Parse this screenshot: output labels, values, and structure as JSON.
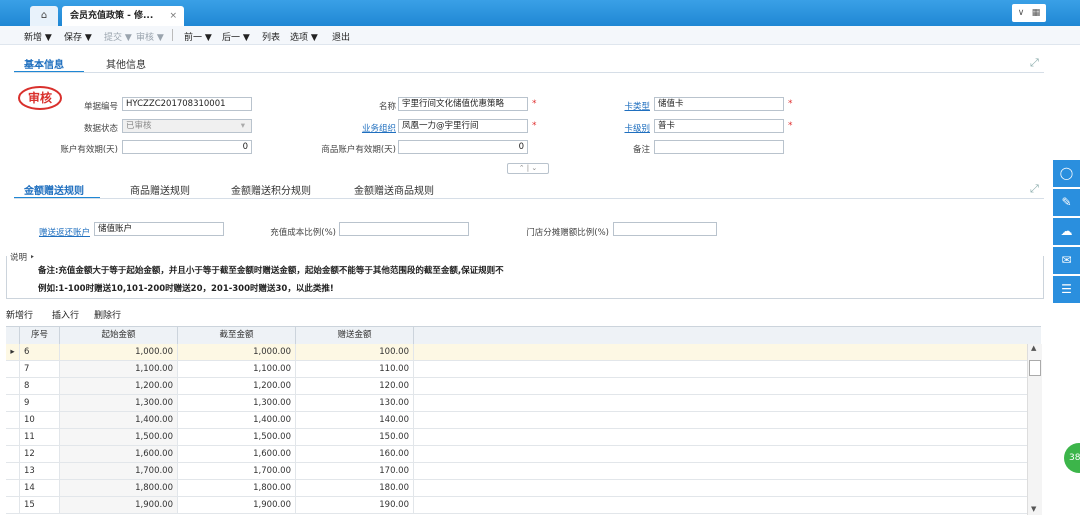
{
  "tabs": {
    "home_icon": "home-icon",
    "doc_tab_label": "会员充值政策 - 修...",
    "close_label": "×"
  },
  "toolbar": {
    "items": [
      {
        "label": "新增 ▼",
        "disabled": false
      },
      {
        "label": "保存 ▼",
        "disabled": false
      },
      {
        "label": "提交 ▼",
        "disabled": true
      },
      {
        "label": "审核 ▼",
        "disabled": true
      },
      {
        "label": "前一 ▼",
        "disabled": false
      },
      {
        "label": "后一 ▼",
        "disabled": false
      },
      {
        "label": "列表",
        "disabled": false
      },
      {
        "label": "选项 ▼",
        "disabled": false
      },
      {
        "label": "退出",
        "disabled": false
      }
    ]
  },
  "header_tabs": {
    "basic": "基本信息",
    "other": "其他信息"
  },
  "stamp": "审核",
  "form": {
    "bill_no_label": "单据编号",
    "bill_no": "HYCZZC201708310001",
    "name_label": "名称",
    "name": "宇里行间文化储值优惠策略",
    "card_type_label": "卡类型",
    "card_type": "储值卡",
    "status_label": "数据状态",
    "status": "已审核",
    "org_label": "业务组织",
    "org": "凤凰一力@宇里行间",
    "card_level_label": "卡级别",
    "card_level": "普卡",
    "valid_days_label": "账户有效期(天)",
    "valid_days": "0",
    "goods_valid_days_label": "商品账户有效期(天)",
    "goods_valid_days": "0",
    "remark_label": "备注",
    "remark": "",
    "req_mark": "*"
  },
  "rule_tabs": [
    "金额赠送规则",
    "商品赠送规则",
    "金额赠送积分规则",
    "金额赠送商品规则"
  ],
  "rule_fields": {
    "return_account_label": "赠送返还账户",
    "return_account": "储值账户",
    "cost_ratio_label": "充值成本比例(%)",
    "cost_ratio": "",
    "store_ratio_label": "门店分摊赠额比例(%)",
    "store_ratio": ""
  },
  "note": {
    "label": "说明",
    "line1": "备注:充值金额大于等于起始金额，并且小于等于截至金额时赠送金额，起始金额不能等于其他范围段的截至金额,保证规则不",
    "line2": "例如:1-100时赠送10,101-200时赠送20，201-300时赠送30，以此类推!"
  },
  "grid_actions": {
    "add_row": "新增行",
    "insert_row": "插入行",
    "delete_row": "删除行"
  },
  "grid": {
    "headers": [
      "序号",
      "起始金额",
      "截至金额",
      "赠送金额"
    ],
    "rows": [
      [
        "6",
        "1,000.00",
        "1,000.00",
        "100.00"
      ],
      [
        "7",
        "1,100.00",
        "1,100.00",
        "110.00"
      ],
      [
        "8",
        "1,200.00",
        "1,200.00",
        "120.00"
      ],
      [
        "9",
        "1,300.00",
        "1,300.00",
        "130.00"
      ],
      [
        "10",
        "1,400.00",
        "1,400.00",
        "140.00"
      ],
      [
        "11",
        "1,500.00",
        "1,500.00",
        "150.00"
      ],
      [
        "12",
        "1,600.00",
        "1,600.00",
        "160.00"
      ],
      [
        "13",
        "1,700.00",
        "1,700.00",
        "170.00"
      ],
      [
        "14",
        "1,800.00",
        "1,800.00",
        "180.00"
      ],
      [
        "15",
        "1,900.00",
        "1,900.00",
        "190.00"
      ]
    ]
  },
  "badge": "38",
  "colors": {
    "accent": "#1f87d4",
    "stamp": "#d9302c",
    "selected_row": "#fdf8e4"
  }
}
